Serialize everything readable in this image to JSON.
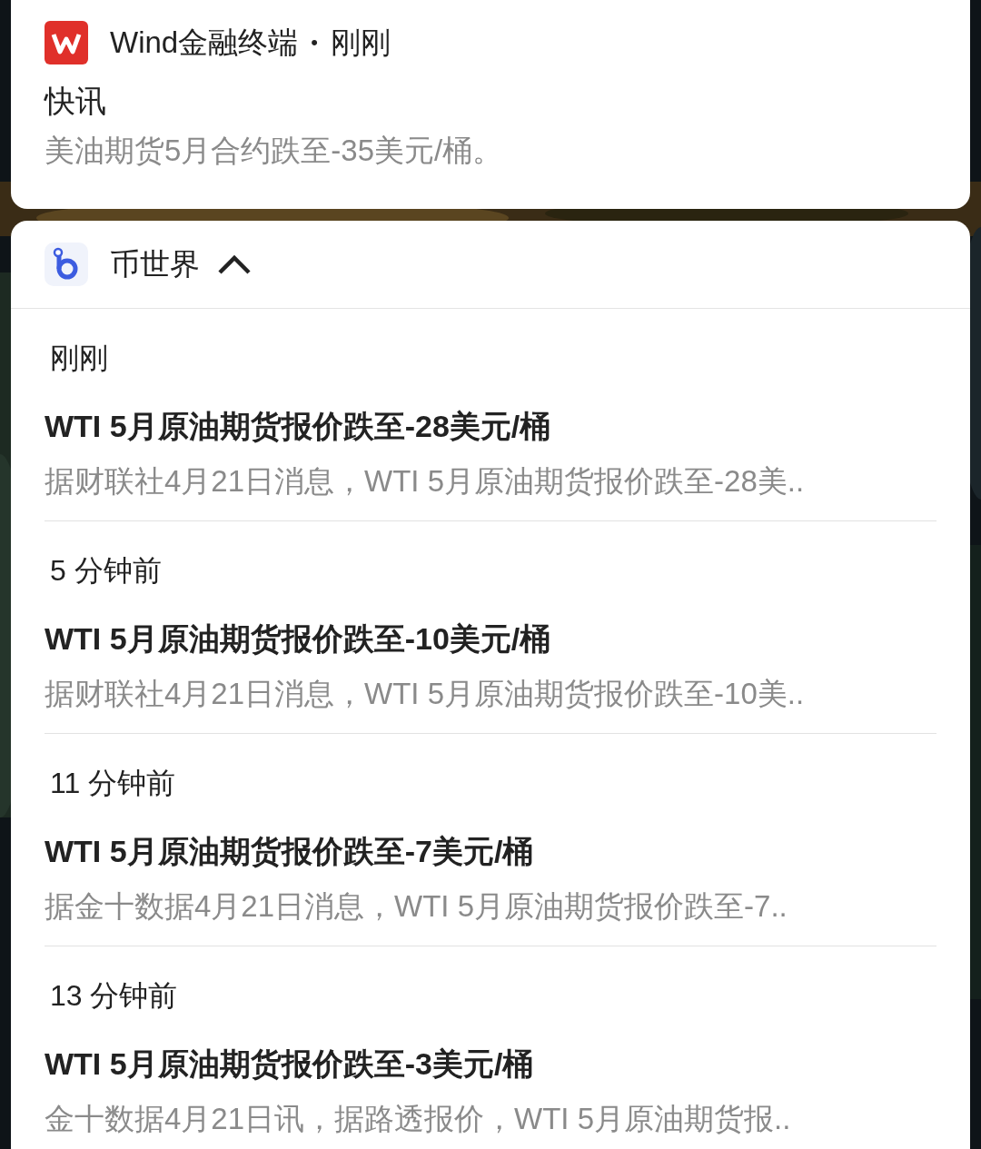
{
  "wind_notification": {
    "app": "Wind金融终端",
    "separator": "•",
    "time": "刚刚",
    "title": "快讯",
    "body": "美油期货5月合约跌至-35美元/桶。"
  },
  "group": {
    "app": "币世界",
    "expanded": true,
    "items": [
      {
        "time": "刚刚",
        "title": "WTI 5月原油期货报价跌至-28美元/桶",
        "body": "据财联社4月21日消息，WTI 5月原油期货报价跌至-28美.."
      },
      {
        "time": "5 分钟前",
        "title": "WTI 5月原油期货报价跌至-10美元/桶",
        "body": "据财联社4月21日消息，WTI 5月原油期货报价跌至-10美.."
      },
      {
        "time": "11 分钟前",
        "title": "WTI 5月原油期货报价跌至-7美元/桶",
        "body": "据金十数据4月21日消息，WTI 5月原油期货报价跌至-7.."
      },
      {
        "time": "13 分钟前",
        "title": "WTI 5月原油期货报价跌至-3美元/桶",
        "body": "金十数据4月21日讯，据路透报价，WTI 5月原油期货报.."
      }
    ]
  }
}
